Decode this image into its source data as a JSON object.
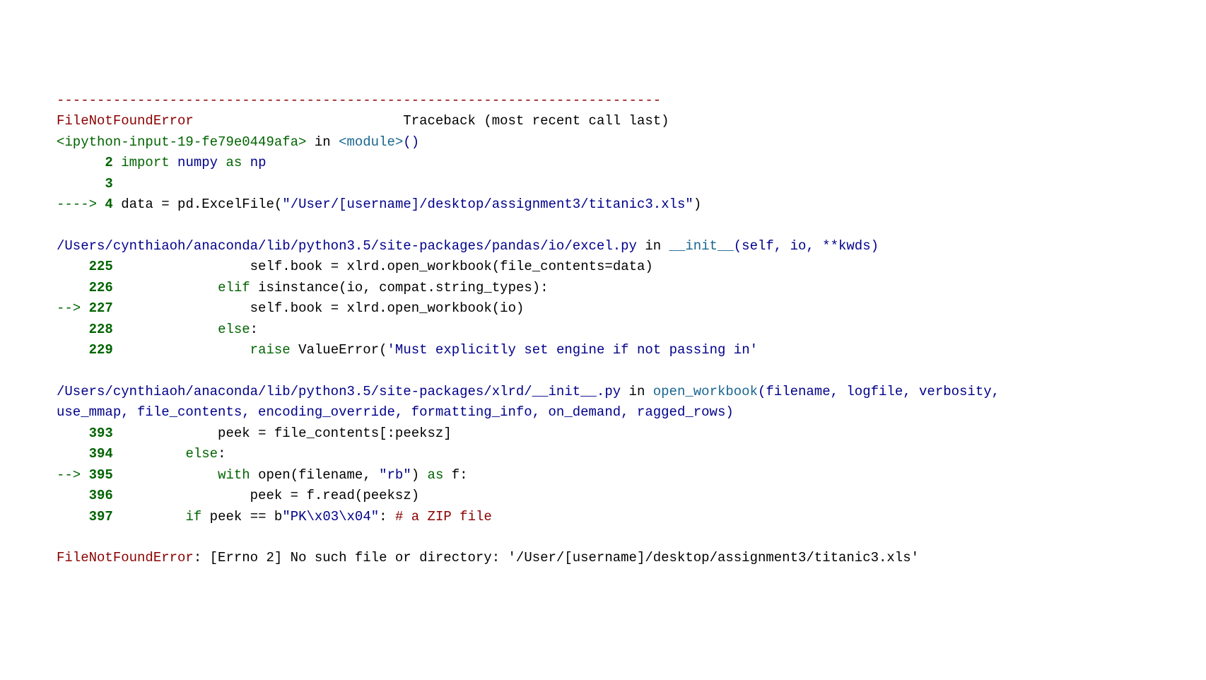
{
  "hr": "---------------------------------------------------------------------------",
  "err": {
    "name": "FileNotFoundError",
    "pad": "                          ",
    "suffix": "Traceback (most recent call last)"
  },
  "frame1": {
    "loc": "<ipython-input-19-fe79e0449afa>",
    "in": " in ",
    "fn": "<module>",
    "sig": "()",
    "l2_num": "      2",
    "l2_kw1": " import",
    "l2_mod": " numpy",
    "l2_kw2": " as",
    "l2_alias": " np",
    "l3_num": "      3",
    "arrow": "----> ",
    "l4_num": "4",
    "l4_code_a": " data ",
    "l4_op": "=",
    "l4_code_b": " pd",
    "l4_dot1": ".",
    "l4_call": "ExcelFile",
    "l4_paren_o": "(",
    "l4_str": "\"/User/[username]/desktop/assignment3/titanic3.xls\"",
    "l4_paren_c": ")"
  },
  "frame2": {
    "path": "/Users/cynthiaoh/anaconda/lib/python3.5/site-packages/pandas/io/excel.py",
    "in": " in ",
    "fn": "__init__",
    "sig": "(self, io, **kwds)",
    "l225_num": "    225",
    "l225_a": "                 self",
    "l225_dot": ".",
    "l225_b": "book ",
    "l225_op": "=",
    "l225_c": " xlrd",
    "l225_dot2": ".",
    "l225_d": "open_workbook",
    "l225_po": "(",
    "l225_e": "file_contents",
    "l225_eq": "=",
    "l225_f": "data",
    "l225_pc": ")",
    "l226_num": "    226",
    "l226_a": "             ",
    "l226_kw": "elif",
    "l226_b": " isinstance",
    "l226_po": "(",
    "l226_c": "io",
    "l226_com": ",",
    "l226_d": " compat",
    "l226_dot": ".",
    "l226_e": "string_types",
    "l226_pc": ")",
    "l226_colon": ":",
    "arrow": "--> ",
    "l227_num": "227",
    "l227_a": "                 self",
    "l227_dot": ".",
    "l227_b": "book ",
    "l227_op": "=",
    "l227_c": " xlrd",
    "l227_dot2": ".",
    "l227_d": "open_workbook",
    "l227_po": "(",
    "l227_e": "io",
    "l227_pc": ")",
    "l228_num": "    228",
    "l228_a": "             ",
    "l228_kw": "else",
    "l228_colon": ":",
    "l229_num": "    229",
    "l229_a": "                 ",
    "l229_kw": "raise",
    "l229_b": " ValueError",
    "l229_po": "(",
    "l229_str": "'Must explicitly set engine if not passing in'"
  },
  "frame3": {
    "path": "/Users/cynthiaoh/anaconda/lib/python3.5/site-packages/xlrd/__init__.py",
    "in": " in ",
    "fn": "open_workbook",
    "sig": "(filename, logfile, verbosity, use_mmap, file_contents, encoding_override, formatting_info, on_demand, ragged_rows)",
    "l393_num": "    393",
    "l393_a": "             peek ",
    "l393_op": "=",
    "l393_b": " file_contents",
    "l393_br": "[:",
    "l393_c": "peeksz",
    "l393_brc": "]",
    "l394_num": "    394",
    "l394_a": "         ",
    "l394_kw": "else",
    "l394_colon": ":",
    "arrow": "--> ",
    "l395_num": "395",
    "l395_a": "             ",
    "l395_kw": "with",
    "l395_b": " open",
    "l395_po": "(",
    "l395_c": "filename",
    "l395_com": ",",
    "l395_str": " \"rb\"",
    "l395_pc": ")",
    "l395_kw2": " as",
    "l395_d": " f",
    "l395_colon": ":",
    "l396_num": "    396",
    "l396_a": "                 peek ",
    "l396_op": "=",
    "l396_b": " f",
    "l396_dot": ".",
    "l396_c": "read",
    "l396_po": "(",
    "l396_d": "peeksz",
    "l396_pc": ")",
    "l397_num": "    397",
    "l397_a": "         ",
    "l397_kw": "if",
    "l397_b": " peek ",
    "l397_op": "==",
    "l397_c": " b",
    "l397_str": "\"PK\\x03\\x04\"",
    "l397_colon": ":",
    "l397_comment": " # a ZIP file"
  },
  "final": {
    "name": "FileNotFoundError",
    "msg": ": [Errno 2] No such file or directory: '/User/[username]/desktop/assignment3/titanic3.xls'"
  }
}
